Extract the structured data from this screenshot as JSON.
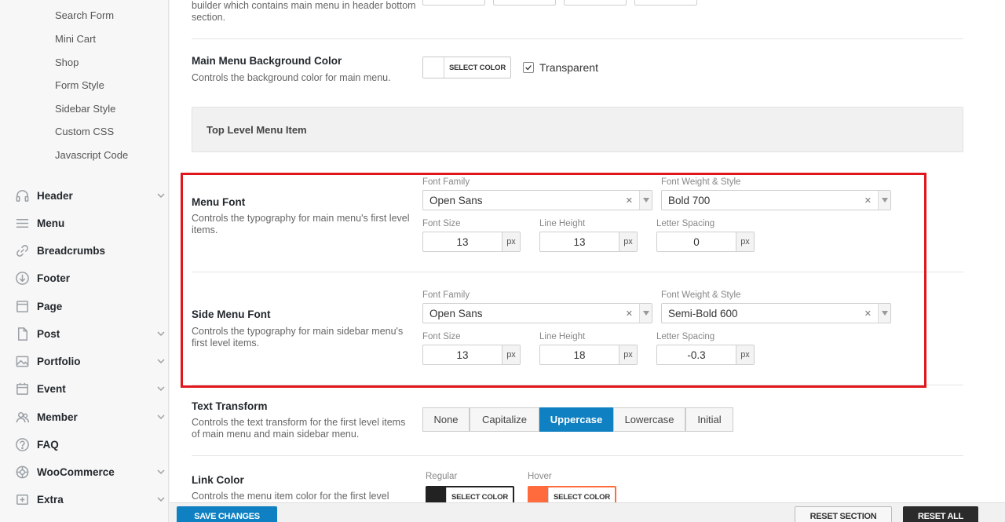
{
  "sidebar": {
    "sub_items": [
      "Search Form",
      "Mini Cart",
      "Shop",
      "Form Style",
      "Sidebar Style",
      "Custom CSS",
      "Javascript Code"
    ],
    "items": [
      {
        "label": "Header",
        "icon": "headphones-icon"
      },
      {
        "label": "Menu",
        "icon": "menu-lines-icon"
      },
      {
        "label": "Breadcrumbs",
        "icon": "link-icon"
      },
      {
        "label": "Footer",
        "icon": "arrow-down-circle-icon"
      },
      {
        "label": "Page",
        "icon": "page-icon"
      },
      {
        "label": "Post",
        "icon": "post-icon"
      },
      {
        "label": "Portfolio",
        "icon": "image-icon"
      },
      {
        "label": "Event",
        "icon": "calendar-icon"
      },
      {
        "label": "Member",
        "icon": "users-icon"
      },
      {
        "label": "FAQ",
        "icon": "question-icon"
      },
      {
        "label": "WooCommerce",
        "icon": "woocommerce-icon"
      },
      {
        "label": "Extra",
        "icon": "extra-icon"
      }
    ]
  },
  "top_row": {
    "desc": "builder which contains main menu in header bottom section."
  },
  "bg_color": {
    "title": "Main Menu Background Color",
    "desc": "Controls the background color for main menu.",
    "button": "SELECT COLOR",
    "transparent_label": "Transparent",
    "transparent_checked": true
  },
  "section_header": "Top Level Menu Item",
  "menu_font": {
    "title": "Menu Font",
    "desc": "Controls the typography for main menu's first level items.",
    "family_label": "Font Family",
    "family": "Open Sans",
    "weight_label": "Font Weight & Style",
    "weight": "Bold 700",
    "size_label": "Font Size",
    "size": "13",
    "line_label": "Line Height",
    "line": "13",
    "spacing_label": "Letter Spacing",
    "spacing": "0",
    "unit": "px"
  },
  "side_menu_font": {
    "title": "Side Menu Font",
    "desc": "Controls the typography for main sidebar menu's first level items.",
    "family_label": "Font Family",
    "family": "Open Sans",
    "weight_label": "Font Weight & Style",
    "weight": "Semi-Bold 600",
    "size_label": "Font Size",
    "size": "13",
    "line_label": "Line Height",
    "line": "18",
    "spacing_label": "Letter Spacing",
    "spacing": "-0.3",
    "unit": "px"
  },
  "text_transform": {
    "title": "Text Transform",
    "desc": "Controls the text transform for the first level items of main menu and main sidebar menu.",
    "options": [
      "None",
      "Capitalize",
      "Uppercase",
      "Lowercase",
      "Initial"
    ],
    "selected": "Uppercase"
  },
  "link_color": {
    "title": "Link Color",
    "desc": "Controls the menu item color for the first level",
    "regular_label": "Regular",
    "hover_label": "Hover",
    "button": "SELECT COLOR",
    "regular_color": "#222222",
    "hover_color": "#ff6b3d"
  },
  "bottom": {
    "save": "SAVE CHANGES",
    "reset_section": "RESET SECTION",
    "reset_all": "RESET ALL"
  },
  "colors": {
    "accent": "#0f80c1",
    "highlight": "#e0161d"
  }
}
